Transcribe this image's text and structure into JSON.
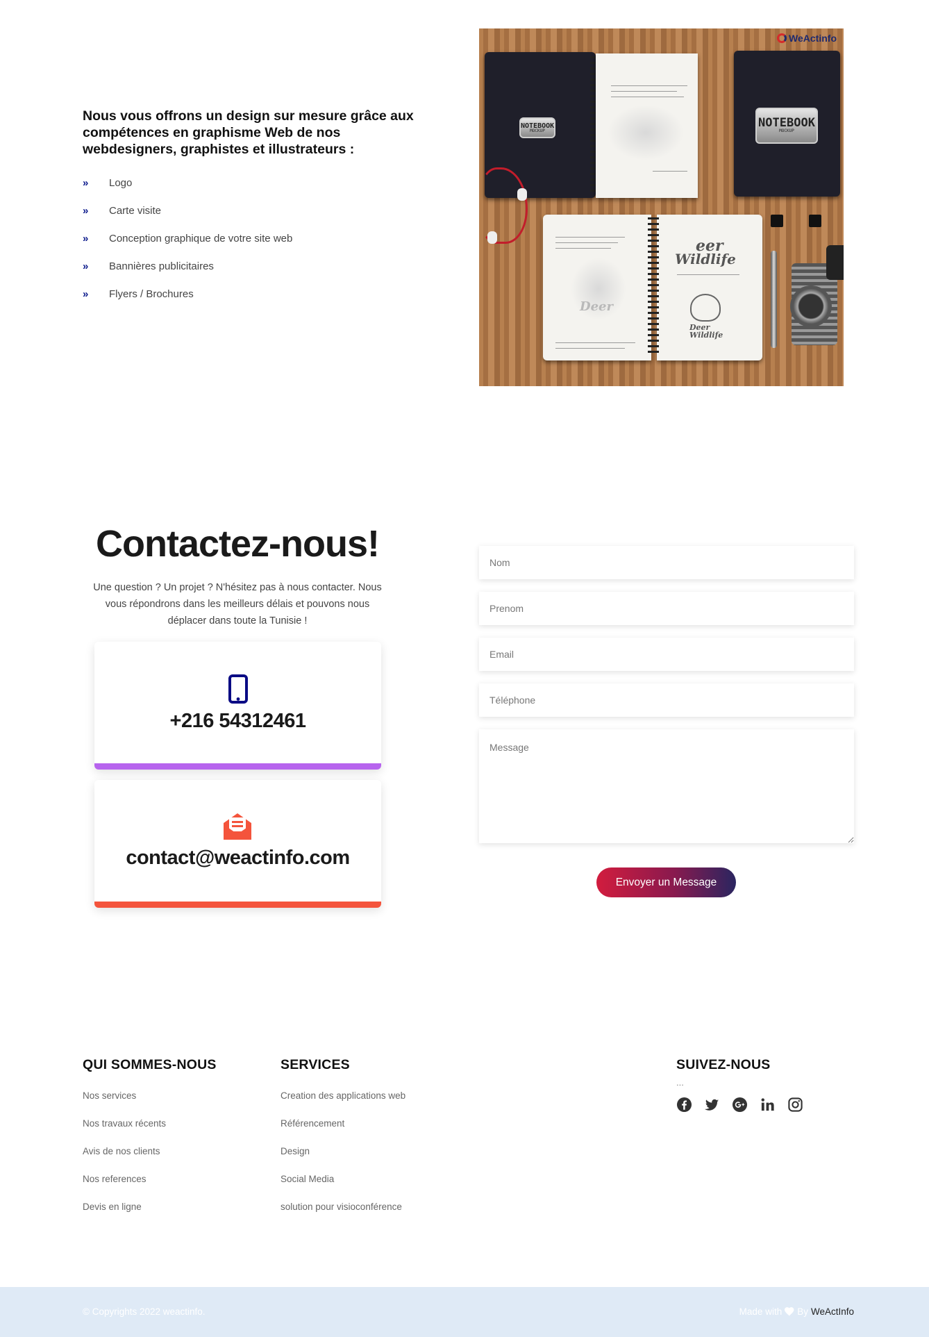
{
  "design": {
    "heading": "Nous vous offrons un design sur mesure grâce aux compétences en graphisme Web de nos webdesigners, graphistes et illustrateurs :",
    "services": [
      "Logo",
      "Carte visite",
      "Conception graphique de votre site web",
      "Bannières publicitaires",
      "Flyers / Brochures"
    ],
    "mockup": {
      "logo_text": "WeActinfo",
      "badge_left": "NOTEBOOK",
      "badge_left_sub": "MOCKUP",
      "badge_right": "NOTEBOOK",
      "badge_right_sub": "MOCKUP",
      "deer_text": "Deer",
      "wildlife_top": "eer",
      "wildlife_bottom": "Wildlife",
      "deer_logo_top": "Deer",
      "deer_logo_bottom": "Wildlife"
    }
  },
  "contact": {
    "title": "Contactez-nous!",
    "intro": "Une question ? Un projet ? N'hésitez pas à nous contacter. Nous vous répondrons dans les meilleurs délais et pouvons nous déplacer dans toute la Tunisie !",
    "phone": "+216 54312461",
    "email": "contact@weactinfo.com",
    "phone_bar_color": "#b764ee",
    "email_bar_color": "#f4543c"
  },
  "form": {
    "nom_placeholder": "Nom",
    "prenom_placeholder": "Prenom",
    "email_placeholder": "Email",
    "tel_placeholder": "Téléphone",
    "message_placeholder": "Message",
    "submit_label": "Envoyer un Message"
  },
  "footer": {
    "about": {
      "title": "QUI SOMMES-NOUS",
      "links": [
        "Nos services",
        "Nos travaux récents",
        "Avis de nos clients",
        "Nos references",
        "Devis en ligne"
      ]
    },
    "services": {
      "title": "SERVICES",
      "links": [
        "Creation des applications web",
        "Référencement",
        "Design",
        "Social Media",
        "solution pour visioconférence"
      ]
    },
    "follow": {
      "title": "SUIVEZ-NOUS",
      "dots": "...",
      "icons": [
        "facebook-icon",
        "twitter-icon",
        "google-plus-icon",
        "linkedin-icon",
        "instagram-icon"
      ]
    },
    "copyright": "© Copyrights 2022 weactinfo.",
    "made_with": "Made with",
    "made_by": "By",
    "brand": "WeActInfo"
  }
}
